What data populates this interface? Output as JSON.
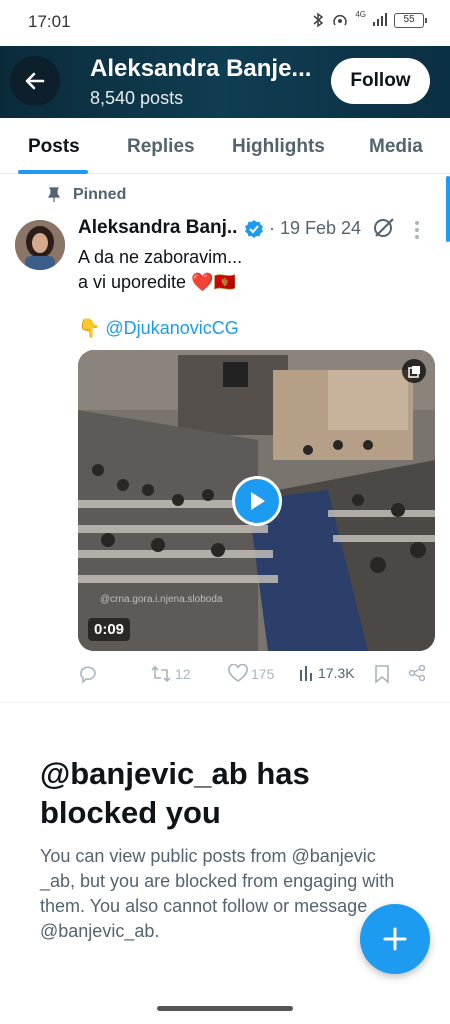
{
  "status_bar": {
    "time": "17:01",
    "network": "4G",
    "battery": "55"
  },
  "header": {
    "name": "Aleksandra Banje...",
    "post_count": "8,540 posts",
    "follow_label": "Follow"
  },
  "tabs": [
    {
      "label": "Posts",
      "active": true
    },
    {
      "label": "Replies",
      "active": false
    },
    {
      "label": "Highlights",
      "active": false
    },
    {
      "label": "Media",
      "active": false
    }
  ],
  "pinned_label": "Pinned",
  "tweet": {
    "author": "Aleksandra Banj...",
    "date": "· 19 Feb 24",
    "line1": "A da ne zaboravim...",
    "line2": "a vi uporedite ❤️🇲🇪",
    "mention": "👇 @DjukanovicCG",
    "video": {
      "duration": "0:09",
      "watermark": "@crna.gora.i.njena.sloboda"
    },
    "actions": {
      "reposts": "12",
      "likes": "175",
      "views": "17.3K"
    }
  },
  "blocked": {
    "title": "@banjevic_ab has blocked you",
    "description": "You can view public posts from @banjevic _ab, but you are blocked from engaging with them. You also cannot follow or message @banjevic_ab."
  },
  "colors": {
    "accent": "#1d9bf0",
    "header_bg": "#0f3d52",
    "text_primary": "#0f1419",
    "text_secondary": "#536471"
  },
  "icons": [
    "back-arrow-icon",
    "pin-icon",
    "verified-icon",
    "grok-icon",
    "more-vertical-icon",
    "reply-icon",
    "repost-icon",
    "like-icon",
    "views-icon",
    "bookmark-icon",
    "share-icon",
    "play-icon",
    "fullscreen-icon",
    "compose-plus-icon"
  ]
}
